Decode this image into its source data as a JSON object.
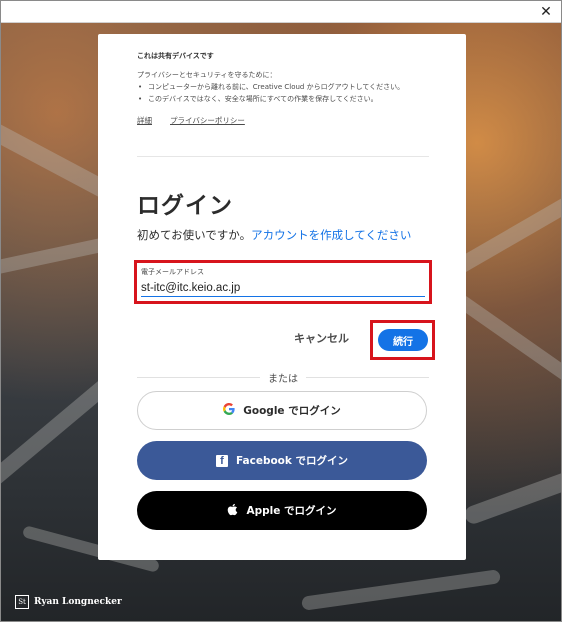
{
  "window": {
    "close_label": "✕"
  },
  "notice": {
    "title": "これは共有デバイスです",
    "intro": "プライバシーとセキュリティを守るために：",
    "items": [
      "コンピューターから離れる前に、Creative Cloud からログアウトしてください。",
      "このデバイスではなく、安全な場所にすべての作業を保存してください。"
    ],
    "links": [
      "詳細",
      "プライバシーポリシー"
    ]
  },
  "login": {
    "heading": "ログイン",
    "signup_prompt": "初めてお使いですか。",
    "signup_link": "アカウントを作成してください",
    "email_label": "電子メールアドレス",
    "email_value": "st-itc@itc.keio.ac.jp",
    "cancel_label": "キャンセル",
    "continue_label": "続行",
    "or_label": "または"
  },
  "social": {
    "google": {
      "brand": "Google",
      "suffix": " でログイン",
      "icon": "google-icon"
    },
    "facebook": {
      "brand": "Facebook",
      "suffix": " でログイン",
      "icon": "facebook-icon"
    },
    "apple": {
      "brand": "Apple",
      "suffix": " でログイン",
      "icon": "apple-icon"
    }
  },
  "credit": {
    "logo": "St",
    "name": "Ryan Longnecker"
  },
  "colors": {
    "accent": "#1473e6",
    "highlight": "#d7141c",
    "facebook": "#3b5998",
    "apple": "#000000"
  }
}
